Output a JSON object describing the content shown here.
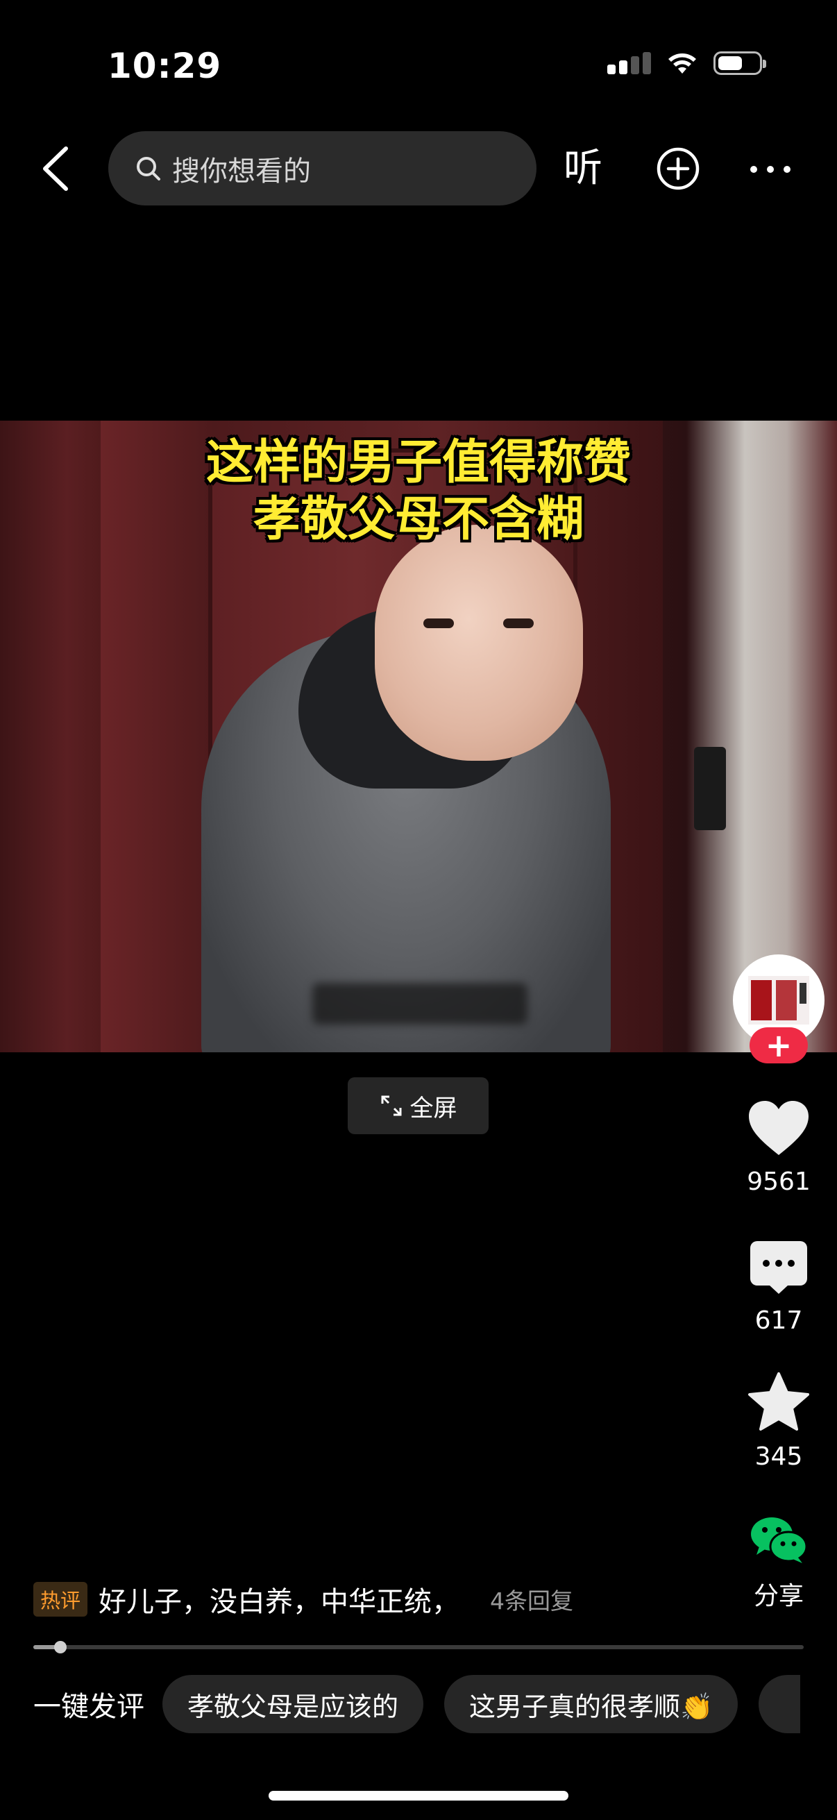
{
  "status_bar": {
    "time": "10:29"
  },
  "top_nav": {
    "search_placeholder": "搜你想看的",
    "listen_label": "听"
  },
  "video": {
    "caption_lines": [
      "这样的男子值得称赞",
      "孝敬父母不含糊"
    ],
    "fullscreen_label": "全屏",
    "progress": 0.035
  },
  "actions": {
    "likes": "9561",
    "comments": "617",
    "favorites": "345",
    "share_label": "分享"
  },
  "hot_comment": {
    "badge": "热评",
    "text": "好儿子，没白养，中华正统，",
    "replies": "4条回复"
  },
  "quick_comment": {
    "label": "一键发评",
    "chips": [
      "孝敬父母是应该的",
      "这男子真的很孝顺👏"
    ]
  },
  "colors": {
    "background": "#000000",
    "caption_yellow": "#ffec33",
    "follow_red": "#ef2b45",
    "wechat_green": "#07c160",
    "hot_badge_orange": "#ff9c2e"
  },
  "icons": [
    "back-icon",
    "search-icon",
    "add-circle-icon",
    "more-icon",
    "fullscreen-icon",
    "heart-icon",
    "comment-icon",
    "star-icon",
    "wechat-icon",
    "plus-icon"
  ]
}
